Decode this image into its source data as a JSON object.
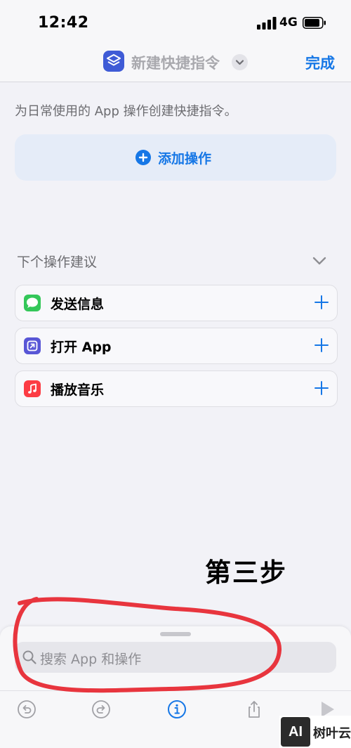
{
  "status_bar": {
    "time": "12:42",
    "network": "4G"
  },
  "nav": {
    "title": "新建快捷指令",
    "done_label": "完成"
  },
  "hint": "为日常使用的 App 操作创建快捷指令。",
  "add_action_label": "添加操作",
  "suggestions": {
    "title": "下个操作建议",
    "items": [
      {
        "label": "发送信息",
        "icon": "messages-icon",
        "color": "#34C759"
      },
      {
        "label": "打开 App",
        "icon": "open-app-icon",
        "color": "#5856D6"
      },
      {
        "label": "播放音乐",
        "icon": "music-icon",
        "color": "#FC3C44"
      }
    ]
  },
  "annotation": "第三步",
  "search": {
    "placeholder": "搜索 App 和操作"
  },
  "toolbar": {
    "icons": [
      "undo-icon",
      "redo-icon",
      "info-icon",
      "share-icon",
      "play-icon"
    ]
  },
  "watermark": {
    "logo": "AI",
    "text": "树叶云"
  },
  "colors": {
    "accent": "#1677E6",
    "annotation_red": "#E8353E"
  }
}
